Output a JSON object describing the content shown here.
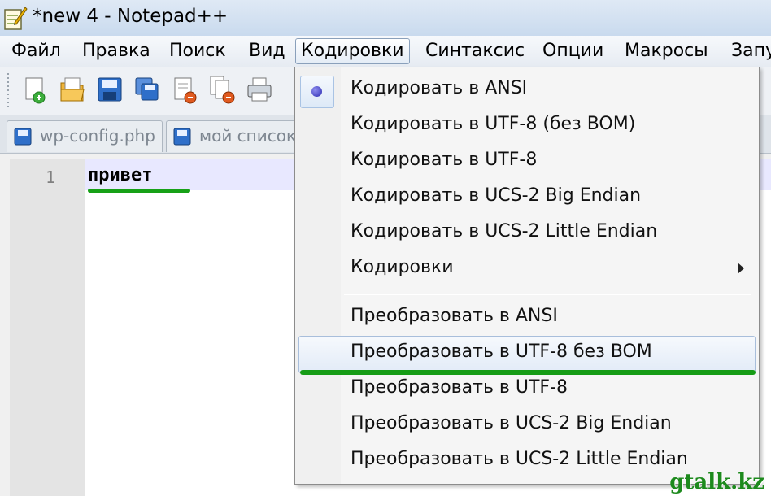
{
  "window": {
    "title": "*new  4 - Notepad++"
  },
  "menubar": {
    "items": [
      "Файл",
      "Правка",
      "Поиск",
      "Вид",
      "Кодировки",
      "Синтаксис",
      "Опции",
      "Макросы",
      "Запу"
    ],
    "active": "Кодировки"
  },
  "toolbar": {
    "icons": [
      "new-file-icon",
      "open-file-icon",
      "save-icon",
      "save-all-icon",
      "close-icon",
      "close-all-icon",
      "print-icon"
    ]
  },
  "tabs": [
    {
      "label": "wp-config.php",
      "icon": "document-icon"
    },
    {
      "label": "мой список",
      "icon": "document-icon"
    }
  ],
  "editor": {
    "line_number": "1",
    "text": "привет"
  },
  "encoding_menu": {
    "items": [
      {
        "label": "Кодировать в ANSI",
        "selected": true
      },
      {
        "label": "Кодировать в UTF-8 (без BOM)"
      },
      {
        "label": "Кодировать в UTF-8"
      },
      {
        "label": "Кодировать в UCS-2 Big Endian"
      },
      {
        "label": "Кодировать в UCS-2 Little Endian"
      },
      {
        "label": "Кодировки",
        "submenu": true
      },
      {
        "label": "Преобразовать в ANSI"
      },
      {
        "label": "Преобразовать в UTF-8 без BOM",
        "hovered": true
      },
      {
        "label": "Преобразовать в UTF-8"
      },
      {
        "label": "Преобразовать в UCS-2 Big Endian"
      },
      {
        "label": "Преобразовать в UCS-2 Little Endian"
      }
    ]
  },
  "watermark": "gtalk.kz",
  "colors": {
    "highlight_green": "#17a117",
    "menu_hover_border": "#a8bedb"
  }
}
